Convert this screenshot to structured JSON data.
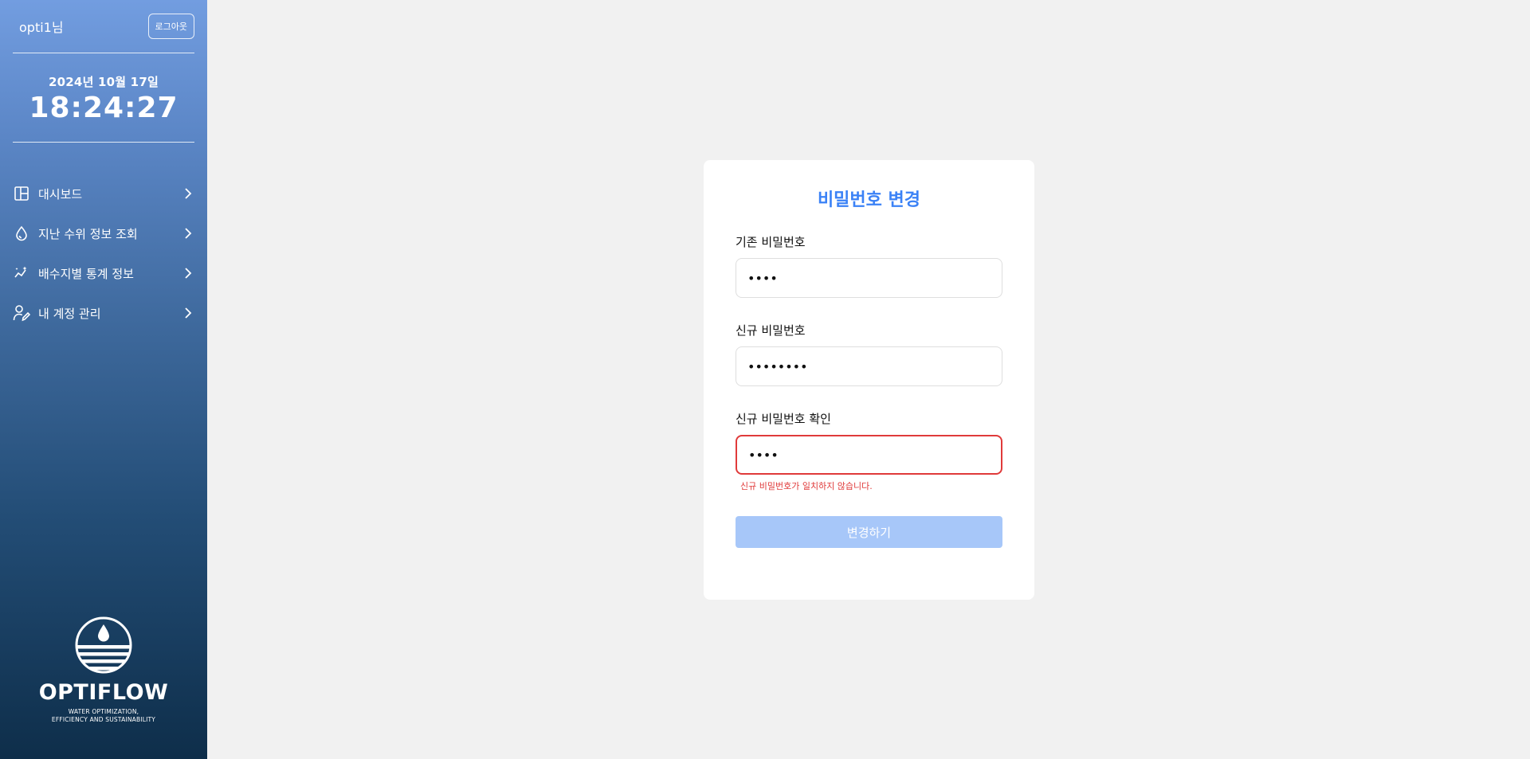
{
  "user": {
    "name": "opti1님",
    "logout_label": "로그아웃"
  },
  "clock": {
    "date": "2024년 10월 17일",
    "time": "18:24:27"
  },
  "nav": {
    "items": [
      {
        "label": "대시보드",
        "icon": "dashboard-icon"
      },
      {
        "label": "지난 수위 정보 조회",
        "icon": "water-drop-icon"
      },
      {
        "label": "배수지별 통계 정보",
        "icon": "chart-sparkle-icon"
      },
      {
        "label": "내 계정 관리",
        "icon": "user-edit-icon"
      }
    ]
  },
  "brand": {
    "name": "OPTIFLOW",
    "tagline_1": "WATER OPTIMIZATION,",
    "tagline_2": "EFFICIENCY AND SUSTAINABILITY"
  },
  "form": {
    "title": "비밀번호 변경",
    "current": {
      "label": "기존 비밀번호",
      "value": "••••"
    },
    "new": {
      "label": "신규 비밀번호",
      "value": "••••••••"
    },
    "confirm": {
      "label": "신규 비밀번호 확인",
      "value": "••••",
      "error": "신규 비밀번호가 일치하지 않습니다."
    },
    "submit_label": "변경하기"
  },
  "colors": {
    "accent": "#3b82f6",
    "button_disabled": "#a7c7f9",
    "error": "#e03a3a",
    "sidebar_top": "#729de0",
    "sidebar_bottom": "#0e2e4a"
  }
}
